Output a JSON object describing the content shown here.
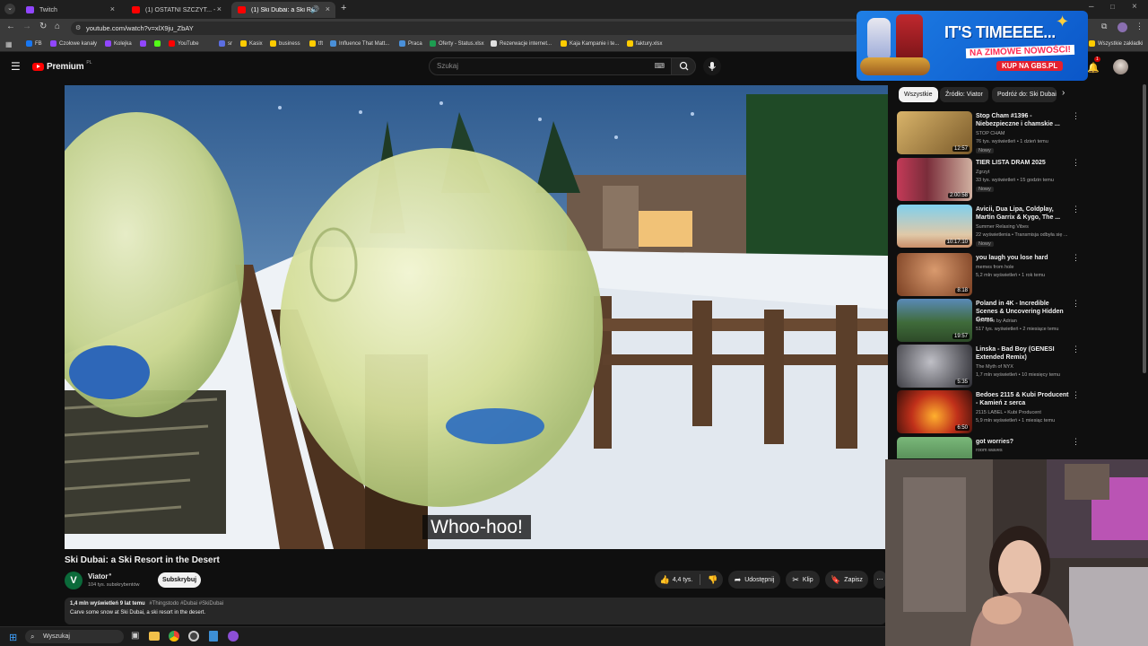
{
  "browser": {
    "tabs": [
      {
        "title": "Twitch",
        "color": "#9146ff"
      },
      {
        "title": "(1) OSTATNI SZCZYT... - YouTube",
        "color": "#ff0000"
      },
      {
        "title": "(1) Ski Dubai: a Ski Resort in ...",
        "color": "#ff0000"
      }
    ],
    "url": "youtube.com/watch?v=xlX9ju_ZbAY",
    "bookmarks": [
      "FB",
      "Czołowe kanały",
      "Kolejka",
      "",
      "",
      "YouTube",
      "sr",
      "Kasix",
      "business",
      "tft",
      "Influence That Matt...",
      "Praca",
      "Oferty - Status.xlsx",
      "Rezerwacje internet...",
      "Kaja Kampanie i te...",
      "faktury.xlsx"
    ],
    "all_bookmarks": "Wszystkie zakładki"
  },
  "youtube": {
    "logo": "Premium",
    "logo_region": "PL",
    "search_placeholder": "Szukaj",
    "notification_count": "1"
  },
  "ad": {
    "headline": "IT'S TIMEEEE...",
    "subline": "NA ZIMOWE NOWOŚCI!",
    "cta": "KUP NA GBS.PL"
  },
  "video": {
    "caption": "Whoo-hoo!",
    "title": "Ski Dubai: a Ski Resort in the Desert",
    "channel": "Viator",
    "subscribers": "104 tys. subskrybentów",
    "subscribe": "Subskrybuj",
    "likes": "4,4 tys.",
    "share": "Udostępnij",
    "clip": "Klip",
    "save": "Zapisz",
    "views_date": "1,4 mln wyświetleń  9 lat temu",
    "tags": "#Thingstodo #Dubai #SkiDubai",
    "description": "Carve some snow at Ski Dubai, a ski resort in the desert."
  },
  "chips": [
    "Wszystkie",
    "Źródło: Viator",
    "Podróż do: Ski Dubai"
  ],
  "recommendations": [
    {
      "title": "Stop Cham #1396 - Niebezpieczne i chamskie ...",
      "channel": "STOP CHAM",
      "meta": "76 tys. wyświetleń • 1 dzień temu",
      "badge": "Nowy",
      "duration": "12:57",
      "thumb": "#b98b3a"
    },
    {
      "title": "TIER LISTA DRAM 2025",
      "channel": "Zgrzyt",
      "meta": "33 tys. wyświetleń • 15 godzin temu",
      "badge": "Nowy",
      "duration": "2:00:58",
      "thumb": "#8a3d4a"
    },
    {
      "title": "Avicii, Dua Lipa, Coldplay, Martin Garrix & Kygo, The ...",
      "channel": "Summer Relaxing Vibes",
      "meta": "22 wyświetlenia • Transmisja odbyła się ...",
      "badge": "Nowy",
      "duration": "10:17:10",
      "thumb": "#5fb8d8"
    },
    {
      "title": "you laugh you lose hard",
      "channel": "memes from hole",
      "meta": "5,2 mln wyświetleń • 1 rok temu",
      "badge": "",
      "duration": "8:18",
      "thumb": "#c98055"
    },
    {
      "title": "Poland in 4K - Incredible Scenes & Uncovering Hidden Gems",
      "channel": "4K Films by Adrian",
      "meta": "517 tys. wyświetleń • 2 miesiące temu",
      "badge": "",
      "duration": "19:57",
      "thumb": "#4a7a3e"
    },
    {
      "title": "Linska - Bad Boy (GENESI Extended Remix)",
      "channel": "The Myth of NYX",
      "meta": "1,7 mln wyświetleń • 10 miesięcy temu",
      "badge": "",
      "duration": "5:35",
      "thumb": "#3c3c44"
    },
    {
      "title": "Bedoes 2115 & Kubi Producent - Kamień z serca",
      "channel": "2115 LABEL • Kubi Producent",
      "meta": "5,9 mln wyświetleń • 1 miesiąc temu",
      "badge": "",
      "duration": "6:50",
      "thumb": "#c0441a"
    },
    {
      "title": "got worries?",
      "channel": "room waves",
      "meta": "",
      "badge": "",
      "duration": "",
      "thumb": "#5a8a5a"
    }
  ],
  "taskbar": {
    "search": "Wyszukaj"
  }
}
